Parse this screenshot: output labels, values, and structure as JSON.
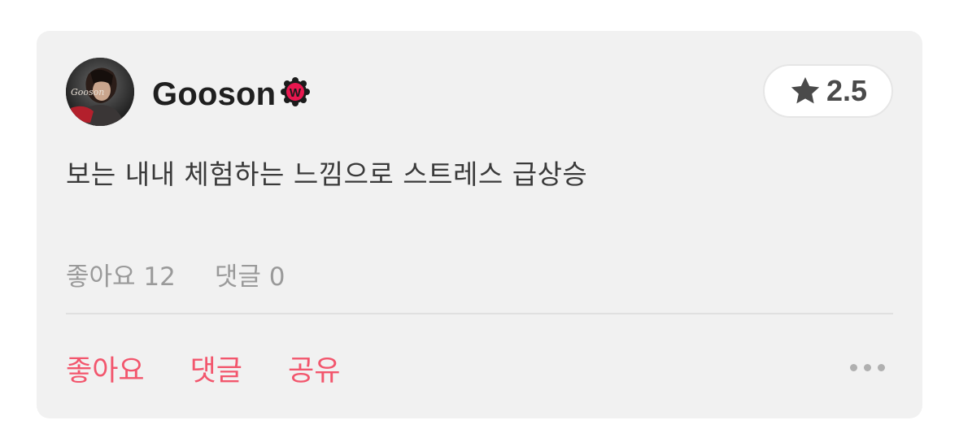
{
  "review": {
    "author": {
      "name": "Gooson",
      "avatar_caption": "Gooson",
      "badge_letter": "W"
    },
    "rating": {
      "icon": "star-icon",
      "value": "2.5"
    },
    "comment": "보는 내내 체험하는 느낌으로 스트레스 급상승",
    "stats": {
      "likes": "좋아요 12",
      "comments": "댓글 0"
    },
    "actions": {
      "like_label": "좋아요",
      "comment_label": "댓글",
      "share_label": "공유",
      "more_icon": "more-horizontal-icon"
    }
  },
  "colors": {
    "accent": "#f2566d",
    "card_bg": "#f1f1f1",
    "badge": "#e8174f"
  }
}
